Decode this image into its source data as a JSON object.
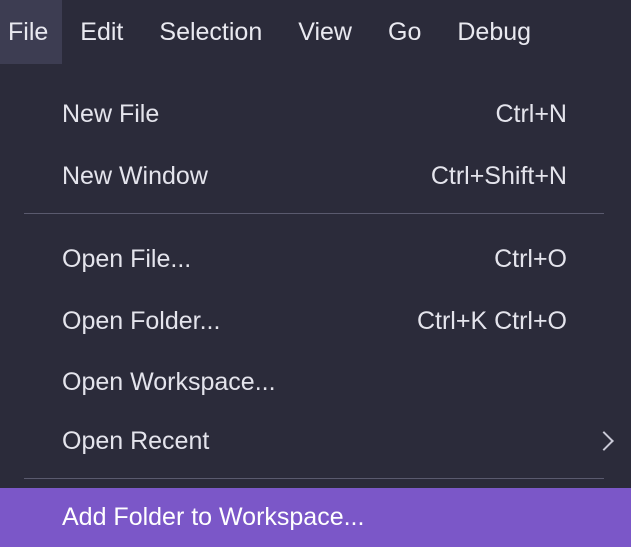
{
  "colors": {
    "background": "#2b2b3a",
    "highlight": "#7b57c8",
    "text": "#e4e4ec",
    "separator": "#5a5a6e"
  },
  "menubar": {
    "items": [
      {
        "label": "File",
        "active": true
      },
      {
        "label": "Edit"
      },
      {
        "label": "Selection"
      },
      {
        "label": "View"
      },
      {
        "label": "Go"
      },
      {
        "label": "Debug"
      }
    ]
  },
  "menu": {
    "items": [
      {
        "label": "New File",
        "shortcut": "Ctrl+N"
      },
      {
        "label": "New Window",
        "shortcut": "Ctrl+Shift+N"
      },
      {
        "label": "Open File...",
        "shortcut": "Ctrl+O"
      },
      {
        "label": "Open Folder...",
        "shortcut": "Ctrl+K Ctrl+O"
      },
      {
        "label": "Open Workspace...",
        "shortcut": ""
      },
      {
        "label": "Open Recent",
        "shortcut": "",
        "icon": "chevron-right-icon"
      },
      {
        "label": "Add Folder to Workspace...",
        "shortcut": "",
        "highlighted": true
      }
    ]
  }
}
